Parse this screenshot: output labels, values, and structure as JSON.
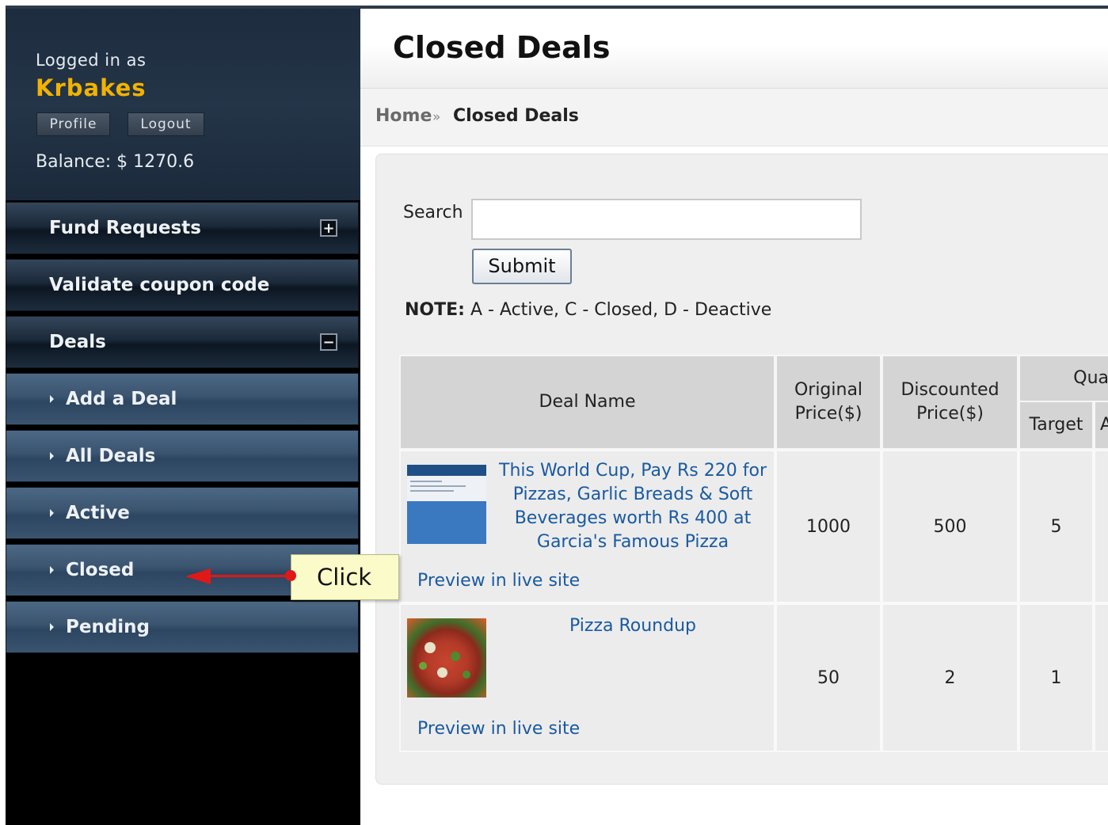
{
  "sidebar": {
    "logged_in_label": "Logged in as",
    "username": "Krbakes",
    "profile_button": "Profile",
    "logout_button": "Logout",
    "balance": "Balance: $ 1270.6",
    "menu": {
      "fund_requests": "Fund Requests",
      "validate_coupon": "Validate coupon code",
      "deals": "Deals"
    },
    "toggles": {
      "expand": "+",
      "collapse": "−"
    },
    "deals_submenu": [
      "Add a Deal",
      "All Deals",
      "Active",
      "Closed",
      "Pending"
    ]
  },
  "header": {
    "title": "Closed Deals"
  },
  "breadcrumb": {
    "home": "Home",
    "separator": "»",
    "current": "Closed Deals"
  },
  "search": {
    "label": "Search",
    "value": "",
    "submit_label": "Submit"
  },
  "note": {
    "prefix": "NOTE:",
    "text": " A - Active, C - Closed, D - Deactive"
  },
  "table": {
    "headers": {
      "deal_name": "Deal Name",
      "original_price_line1": "Original",
      "original_price_line2": "Price($)",
      "discounted_price_line1": "Discounted",
      "discounted_price_line2": "Price($)",
      "quantity": "Qua",
      "target": "Target",
      "next_partial": "A"
    },
    "rows": [
      {
        "title_lines": [
          "This World Cup, Pay Rs 220 for",
          "Pizzas, Garlic Breads & Soft",
          "Beverages worth Rs 400 at",
          "Garcia's Famous Pizza"
        ],
        "preview": "Preview in live site",
        "original_price": "1000",
        "discounted_price": "500",
        "target": "5"
      },
      {
        "title_lines": [
          "Pizza Roundup"
        ],
        "preview": "Preview in live site",
        "original_price": "50",
        "discounted_price": "2",
        "target": "1"
      }
    ]
  },
  "callout": {
    "text": "Click"
  },
  "colors": {
    "accent_username": "#f2b200",
    "link": "#1a5aa0",
    "callout_arrow": "#e01818"
  }
}
